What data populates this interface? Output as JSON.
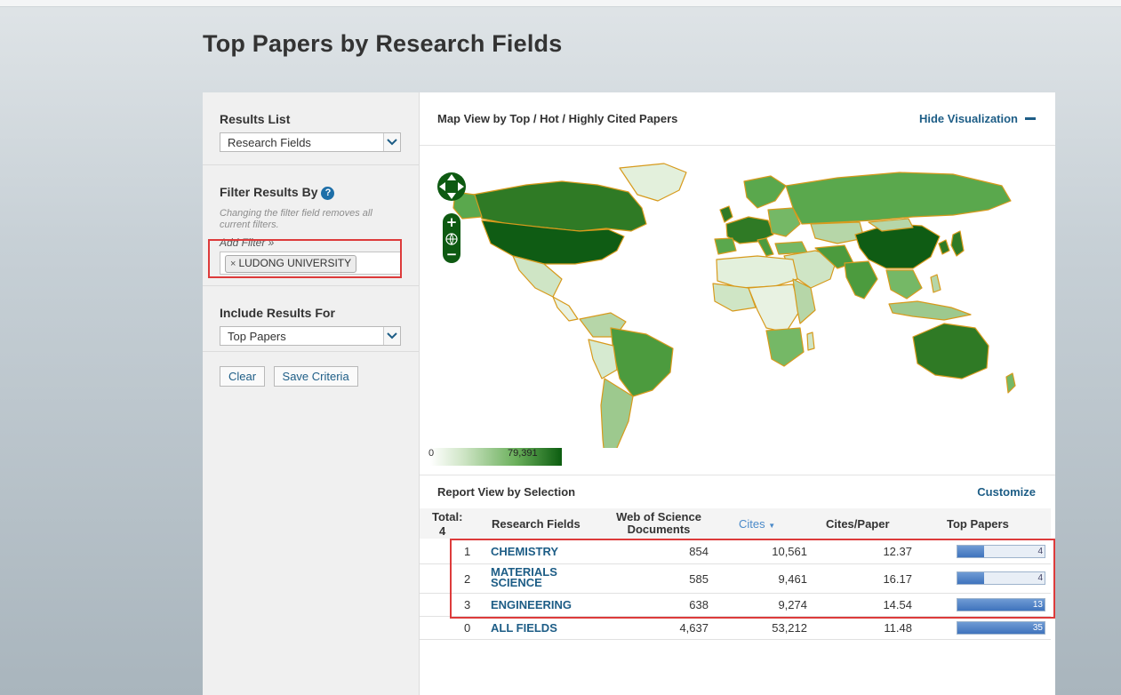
{
  "page": {
    "title": "Top Papers by Research Fields"
  },
  "left_panel": {
    "results_list": {
      "heading": "Results List",
      "selected": "Research Fields"
    },
    "filter": {
      "heading": "Filter Results By",
      "help_glyph": "?",
      "hint": "Changing the filter field removes all current filters.",
      "add_filter_label": "Add Filter »",
      "tag_remove": "×",
      "tag": "LUDONG UNIVERSITY"
    },
    "include": {
      "heading": "Include Results For",
      "selected": "Top Papers"
    },
    "buttons": {
      "clear": "Clear",
      "save": "Save Criteria"
    }
  },
  "map": {
    "title": "Map View by Top / Hot / Highly Cited Papers",
    "hide_label": "Hide Visualization",
    "legend_min": "0",
    "legend_max": "79,391",
    "colors": {
      "low": "#ffffff",
      "mid": "#6bb05c",
      "high": "#0c5d10",
      "border": "#d79a1c"
    }
  },
  "report": {
    "title": "Report View by Selection",
    "customize": "Customize",
    "headers": {
      "total_label": "Total:",
      "total_value": "4",
      "field": "Research Fields",
      "wos": "Web of Science Documents",
      "cites": "Cites",
      "cites_per_paper": "Cites/Paper",
      "top_papers": "Top Papers"
    },
    "rows": [
      {
        "rank": "1",
        "field": "CHEMISTRY",
        "wos": "854",
        "cites": "10,561",
        "cpp": "12.37",
        "top": "4",
        "fraction": 0.31
      },
      {
        "rank": "2",
        "field": "MATERIALS SCIENCE",
        "wos": "585",
        "cites": "9,461",
        "cpp": "16.17",
        "top": "4",
        "fraction": 0.31
      },
      {
        "rank": "3",
        "field": "ENGINEERING",
        "wos": "638",
        "cites": "9,274",
        "cpp": "14.54",
        "top": "13",
        "fraction": 1.0
      }
    ],
    "total_row": {
      "rank": "0",
      "field": "ALL FIELDS",
      "wos": "4,637",
      "cites": "53,212",
      "cpp": "11.48",
      "top": "35",
      "fraction": 1.0
    }
  }
}
